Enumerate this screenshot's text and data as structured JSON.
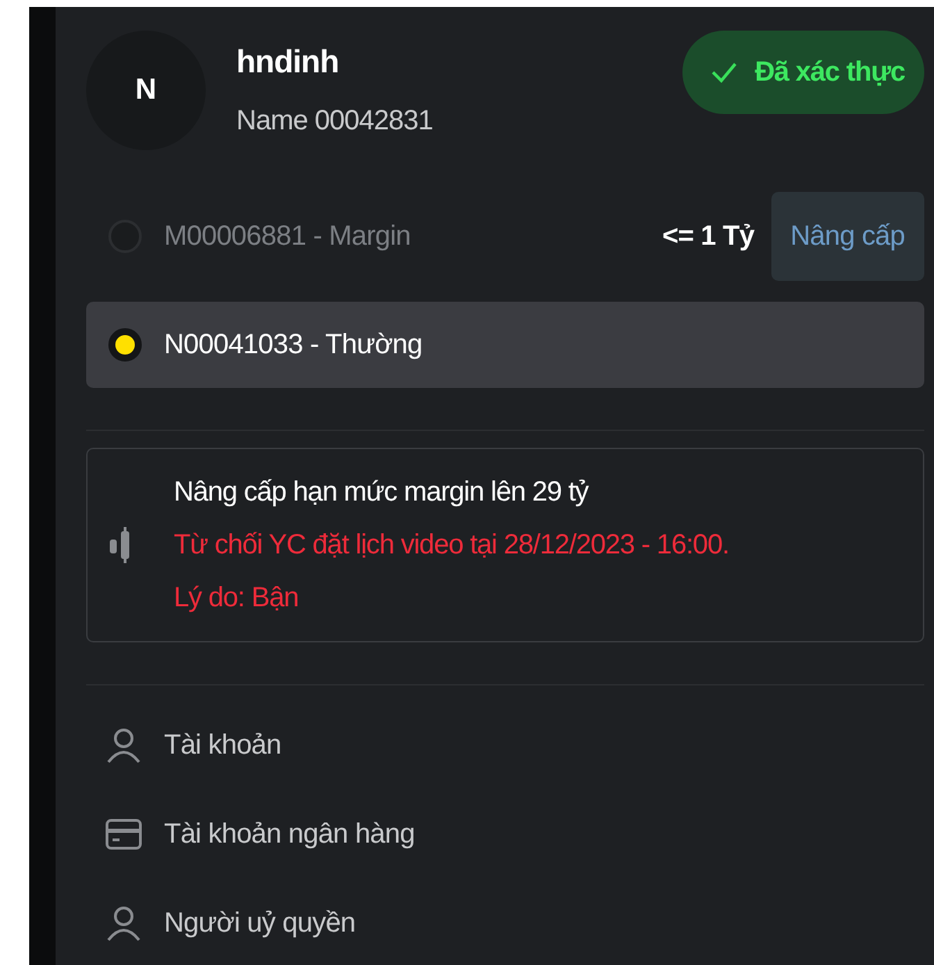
{
  "user": {
    "avatar_letter": "N",
    "username": "hndinh",
    "display_name": "Name 00042831",
    "verified": true,
    "verified_label": "Đã xác thực"
  },
  "accounts": [
    {
      "kind": "upgradable",
      "label": "M00006881 - Margin",
      "selected": false,
      "limit": "<= 1 Tỷ",
      "action": "Nâng cấp"
    },
    {
      "kind": "plain",
      "label": "N00041033 - Thường",
      "selected": true
    }
  ],
  "notice": {
    "title": "Nâng cấp hạn mức margin lên 29 tỷ",
    "lines": [
      "Từ chối YC đặt lịch video tại 28/12/2023 - 16:00.",
      "Lý do: Bận"
    ]
  },
  "menu": [
    {
      "kind": "person",
      "label": "Tài khoản"
    },
    {
      "kind": "card",
      "label": "Tài khoản ngân hàng"
    },
    {
      "kind": "person",
      "label": "Người uỷ quyền"
    }
  ]
}
